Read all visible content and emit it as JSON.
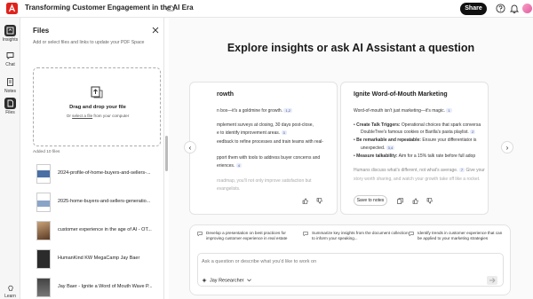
{
  "app": {
    "title": "Transforming Customer Engagement in the AI Era",
    "share_label": "Share"
  },
  "rail": {
    "items": [
      {
        "label": "Insights",
        "icon": "insights-icon",
        "active": true
      },
      {
        "label": "Chat",
        "icon": "chat-icon",
        "active": false
      },
      {
        "label": "Notes",
        "icon": "notes-icon",
        "active": false
      },
      {
        "label": "Files",
        "icon": "files-icon",
        "active": true
      }
    ],
    "learn_label": "Learn"
  },
  "files_panel": {
    "title": "Files",
    "subtitle": "Add or select files and links to update your PDF Space",
    "dropzone": {
      "title": "Drag and drop your file",
      "prefix": "Or",
      "link": "select a file",
      "suffix": "from your computer"
    },
    "added_label": "Added 10 files",
    "files": [
      {
        "name": "2024-profile-of-home-buyers-and-sellers-..."
      },
      {
        "name": "2025-home-buyers-and-sellers-generatio..."
      },
      {
        "name": "customer experience in the age of AI - OT..."
      },
      {
        "name": "HumanKind KW MegaCamp Jay Baer"
      },
      {
        "name": "Jay Baer - Ignite a Word of Mouth Wave P..."
      }
    ]
  },
  "main": {
    "headline": "Explore insights or ask AI Assistant a question",
    "card_a": {
      "title": "rowth",
      "lines": [
        {
          "text": "n box—it's a goldmine for growth.",
          "cite": "1,2"
        },
        {
          "text": "mplement surveys at closing, 30 days post-close,",
          "cite": ""
        },
        {
          "text": "e to identify improvement areas.",
          "cite": "3"
        },
        {
          "text": "eedback to refine processes and train teams with real-",
          "cite": ""
        },
        {
          "text": "",
          "cite": ""
        },
        {
          "text": "pport them with tools to address buyer concerns and",
          "cite": ""
        },
        {
          "text": "eriences.",
          "cite": "4"
        }
      ],
      "fade1": "roadmap, you'll not only improve satisfaction but",
      "fade2": "evangelists."
    },
    "card_b": {
      "title": "Ignite Word-of-Mouth Marketing",
      "intro": "Word-of-mouth isn't just marketing—it's magic.",
      "intro_cite": "1",
      "bullets": [
        {
          "bold": "Create Talk Triggers:",
          "text": " Operational choices that spark conversa",
          "cont": "DoubleTree's famous cookies or Barilla's pasta playlist.",
          "cite": "2"
        },
        {
          "bold": "Be remarkable and repeatable:",
          "text": " Ensure your differentiator is",
          "cont": "unexpected.",
          "cite": "3,4"
        },
        {
          "bold": "Measure talkability:",
          "text": " Aim for a 15% talk rate before full adop",
          "cont": "",
          "cite": ""
        }
      ],
      "fade1": "Humans discuss what's different, not what's average.",
      "fade1_cite": "7",
      "fade1_tail": " Give your",
      "fade2": "story worth sharing, and watch your growth take off like a rocket.",
      "save_label": "Save to notes"
    },
    "suggestions": [
      "Develop a presentation on best practices for improving customer experience in real estate",
      "Summarize key insights from the document collection to inform your speaking...",
      "Identify trends in customer experience that can be applied to your marketing strategies"
    ],
    "ask_placeholder": "Ask a question or describe what you'd like to work on",
    "researcher_label": "Jay Researcher"
  }
}
